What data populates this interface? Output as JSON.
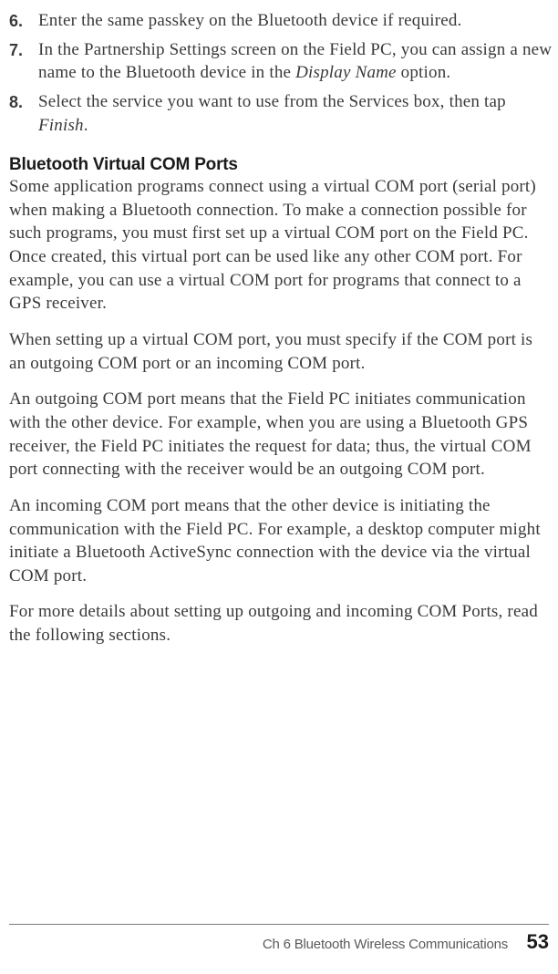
{
  "list": {
    "items": [
      {
        "num": "6.",
        "text_before": "Enter the same passkey on the Bluetooth device if required.",
        "italic1": "",
        "text_mid": "",
        "italic2": "",
        "text_after": ""
      },
      {
        "num": "7.",
        "text_before": "In the Partnership Settings screen on the Field PC, you can assign a new name to the Bluetooth device in the ",
        "italic1": "Display Name",
        "text_mid": " option.",
        "italic2": "",
        "text_after": ""
      },
      {
        "num": "8.",
        "text_before": "Select the service you want to use from the Services box, then tap ",
        "italic1": "Finish",
        "text_mid": ".",
        "italic2": "",
        "text_after": ""
      }
    ]
  },
  "heading": "Bluetooth Virtual COM Ports",
  "paragraphs": {
    "p1": "Some application programs connect using a virtual COM port (serial port) when making a Bluetooth connection. To make a connection possible for such programs, you must first set up a virtual COM port on the Field PC. Once created, this virtual port can be used like any other COM port. For example, you can use a virtual COM port for programs that connect to a GPS receiver.",
    "p2": "When setting up a virtual COM port, you must specify if the COM port is an outgoing COM port or an incoming COM port.",
    "p3": "An outgoing COM port means that the Field PC initiates communication with the other device. For example, when you are using a Bluetooth GPS receiver, the Field PC initiates the request for data; thus, the virtual COM port connecting with the receiver would be an outgoing COM port.",
    "p4": "An incoming COM port means that the other device is initiating the communication with the Field PC. For example, a desktop computer might initiate a Bluetooth ActiveSync connection with the device via the virtual COM port.",
    "p5": "For more details about setting up outgoing and incoming COM Ports, read the following sections."
  },
  "footer": {
    "chapter": "Ch 6     Bluetooth Wireless Communications",
    "page": "53"
  }
}
